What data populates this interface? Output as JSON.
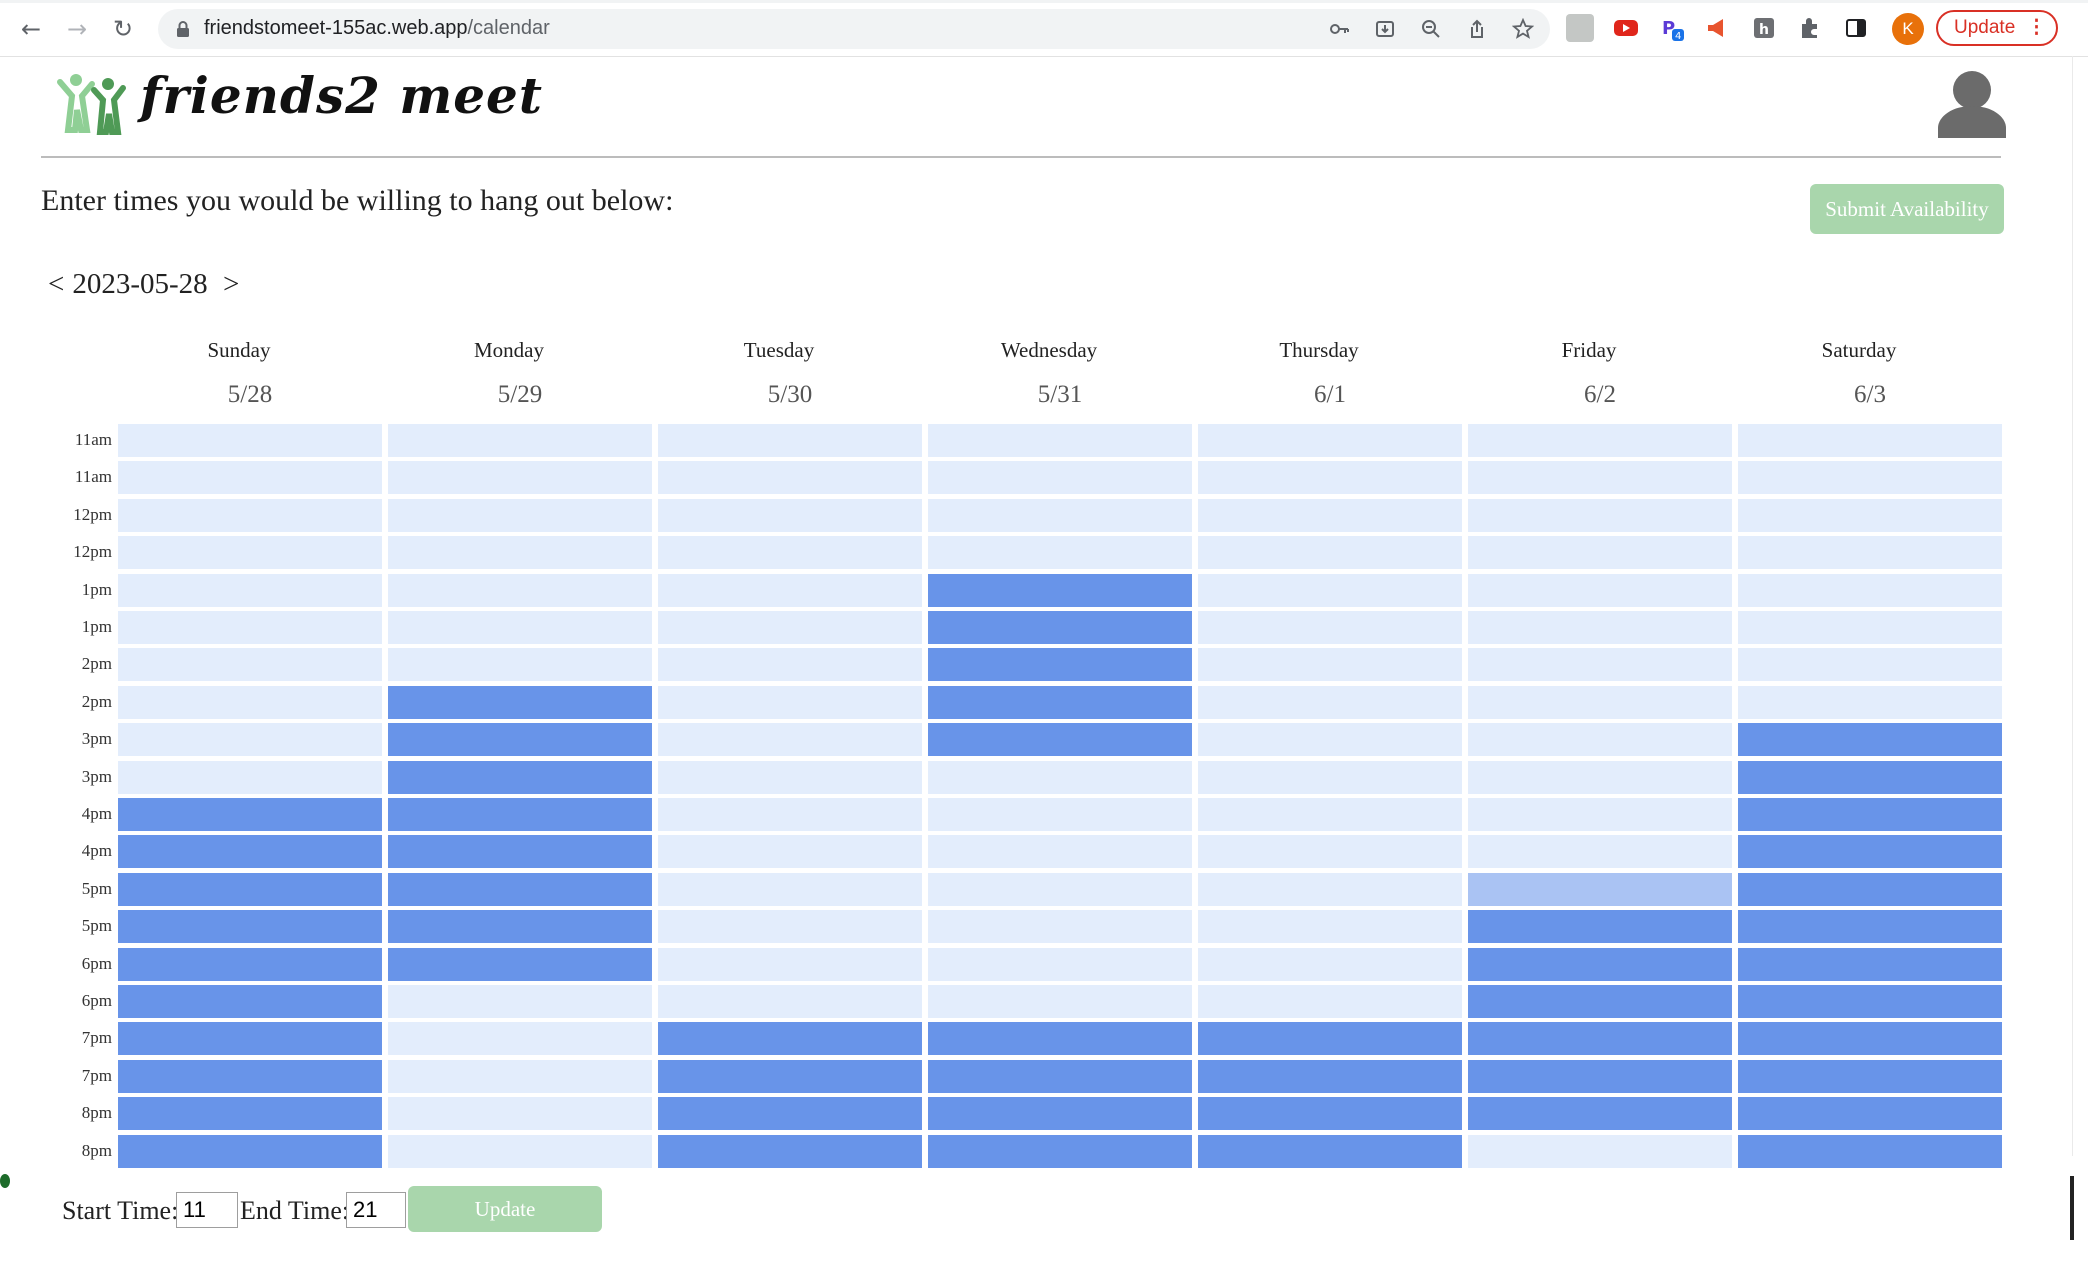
{
  "browser": {
    "url_host": "friendstomeet-155ac.web.app",
    "url_path": "/calendar",
    "update_label": "Update",
    "profile_initial": "K"
  },
  "app": {
    "logo_text": "friends2 meet",
    "instructions": "Enter times you would be willing to hang out below:",
    "submit_label": "Submit Availability",
    "week_prev": "<",
    "week_date": "2023-05-28",
    "week_next": ">"
  },
  "colors": {
    "available": "#6894e9",
    "unavailable": "#e3edfc",
    "pending": "#aac3f3",
    "button_green": "#a9d6ac"
  },
  "calendar": {
    "days": [
      {
        "name": "Sunday",
        "date": "5/28"
      },
      {
        "name": "Monday",
        "date": "5/29"
      },
      {
        "name": "Tuesday",
        "date": "5/30"
      },
      {
        "name": "Wednesday",
        "date": "5/31"
      },
      {
        "name": "Thursday",
        "date": "6/1"
      },
      {
        "name": "Friday",
        "date": "6/2"
      },
      {
        "name": "Saturday",
        "date": "6/3"
      }
    ],
    "time_slots": [
      "11am",
      "11am",
      "12pm",
      "12pm",
      "1pm",
      "1pm",
      "2pm",
      "2pm",
      "3pm",
      "3pm",
      "4pm",
      "4pm",
      "5pm",
      "5pm",
      "6pm",
      "6pm",
      "7pm",
      "7pm",
      "8pm",
      "8pm"
    ],
    "availability": [
      [
        0,
        0,
        0,
        0,
        0,
        0,
        0
      ],
      [
        0,
        0,
        0,
        0,
        0,
        0,
        0
      ],
      [
        0,
        0,
        0,
        0,
        0,
        0,
        0
      ],
      [
        0,
        0,
        0,
        0,
        0,
        0,
        0
      ],
      [
        0,
        0,
        0,
        1,
        0,
        0,
        0
      ],
      [
        0,
        0,
        0,
        1,
        0,
        0,
        0
      ],
      [
        0,
        0,
        0,
        1,
        0,
        0,
        0
      ],
      [
        0,
        1,
        0,
        1,
        0,
        0,
        0
      ],
      [
        0,
        1,
        0,
        1,
        0,
        0,
        1
      ],
      [
        0,
        1,
        0,
        0,
        0,
        0,
        1
      ],
      [
        1,
        1,
        0,
        0,
        0,
        0,
        1
      ],
      [
        1,
        1,
        0,
        0,
        0,
        0,
        1
      ],
      [
        1,
        1,
        0,
        0,
        0,
        2,
        1
      ],
      [
        1,
        1,
        0,
        0,
        0,
        1,
        1
      ],
      [
        1,
        1,
        0,
        0,
        0,
        1,
        1
      ],
      [
        1,
        0,
        0,
        0,
        0,
        1,
        1
      ],
      [
        1,
        0,
        1,
        1,
        1,
        1,
        1
      ],
      [
        1,
        0,
        1,
        1,
        1,
        1,
        1
      ],
      [
        1,
        0,
        1,
        1,
        1,
        1,
        1
      ],
      [
        1,
        0,
        1,
        1,
        1,
        0,
        1
      ]
    ]
  },
  "controls": {
    "start_label": "Start Time:",
    "start_value": "11",
    "end_label": "End Time:",
    "end_value": "21",
    "update_label": "Update"
  }
}
